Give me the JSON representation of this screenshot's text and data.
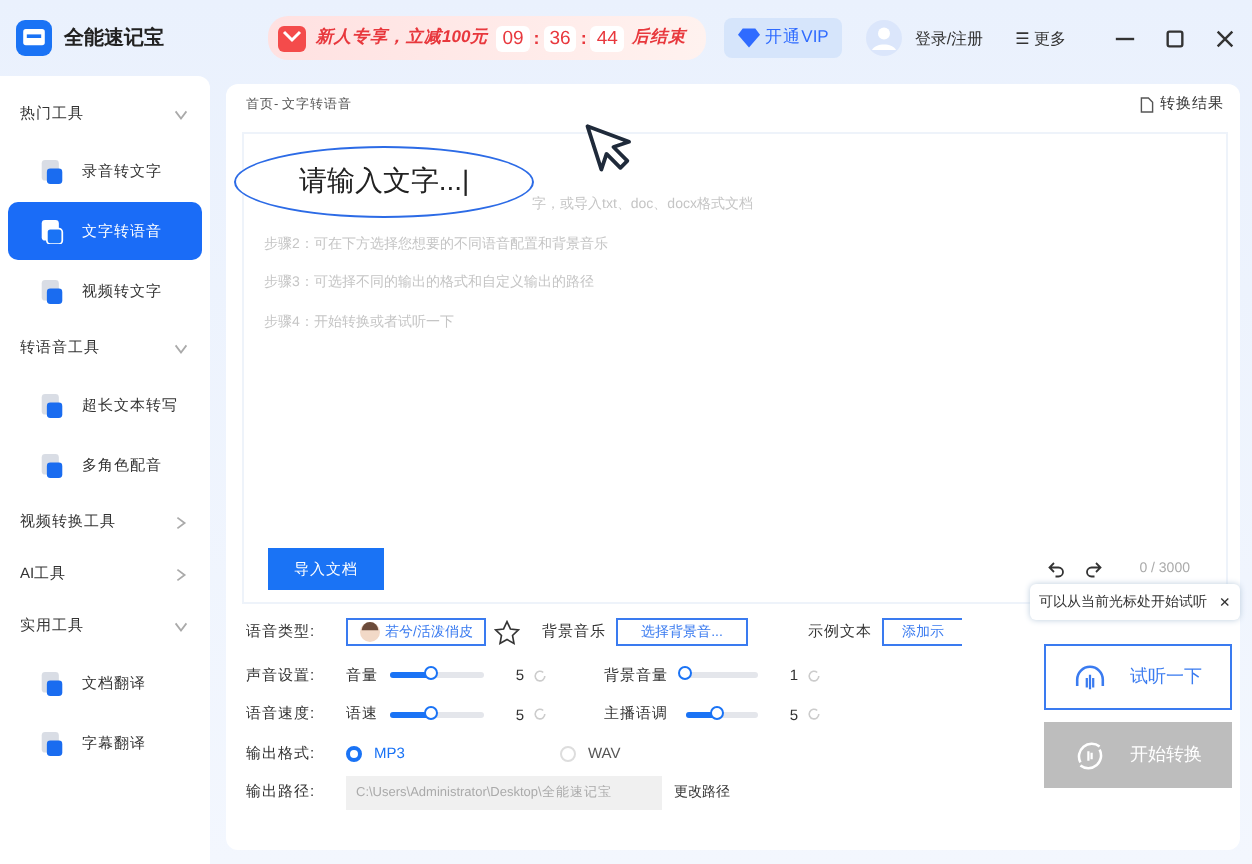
{
  "app": {
    "title": "全能速记宝"
  },
  "promo": {
    "text": "新人专享，立减100元",
    "timer": [
      "09",
      "36",
      "44"
    ],
    "separator": ":",
    "suffix": "后结束"
  },
  "header": {
    "vip": "开通VIP",
    "login": "登录/注册",
    "more_icon": "☰",
    "more": "更多"
  },
  "sidebar": [
    {
      "label": "热门工具",
      "expanded": true,
      "items": [
        {
          "label": "录音转文字",
          "selected": false
        },
        {
          "label": "文字转语音",
          "selected": true
        },
        {
          "label": "视频转文字",
          "selected": false
        }
      ]
    },
    {
      "label": "转语音工具",
      "expanded": true,
      "items": [
        {
          "label": "超长文本转写",
          "selected": false
        },
        {
          "label": "多角色配音",
          "selected": false
        }
      ]
    },
    {
      "label": "视频转换工具",
      "expanded": false
    },
    {
      "label": "AI工具",
      "expanded": false
    },
    {
      "label": "实用工具",
      "expanded": true,
      "items": [
        {
          "label": "文档翻译",
          "selected": false
        },
        {
          "label": "字幕翻译",
          "selected": false
        }
      ]
    }
  ],
  "breadcrumb": "首页- 文字转语音",
  "result_link": "转换结果",
  "editor": {
    "steps": [
      "字，或导入txt、doc、docx格式文档",
      "步骤2：可在下方选择您想要的不同语音配置和背景音乐",
      "步骤3：可选择不同的输出的格式和自定义输出的路径",
      "步骤4：开始转换或者试听一下"
    ],
    "import_button": "导入文档",
    "counter": "0 / 3000"
  },
  "callout": {
    "text": "请输入文字...|"
  },
  "settings": {
    "voice_label": "语音类型:",
    "voice_button": "若兮/活泼俏皮",
    "favorite": false,
    "music_label": "背景音乐",
    "music_button": "选择背景音...",
    "sample_label": "示例文本",
    "sample_button": "添加示",
    "slider_rows": [
      {
        "label": "声音设置:",
        "sliders": [
          {
            "label": "音量",
            "level": 0.45,
            "reading": "5"
          },
          {
            "label": "背景音量",
            "level": 0,
            "reading": "1"
          }
        ]
      },
      {
        "label": "语音速度:",
        "sliders": [
          {
            "label": "语速",
            "level": 0.45,
            "reading": "5"
          },
          {
            "label": "主播语调",
            "level": 0.45,
            "reading": "5"
          }
        ]
      }
    ],
    "format_label": "输出格式:",
    "formats": [
      {
        "label": "MP3",
        "selected": true
      },
      {
        "label": "WAV",
        "selected": false
      }
    ],
    "path_label": "输出路径:",
    "path": "C:\\Users\\Administrator\\Desktop\\全能速记宝",
    "change_path": "更改路径"
  },
  "tooltip": {
    "text": "可以从当前光标处开始试听",
    "close": "×"
  },
  "preview_button": {
    "label": "试听一下",
    "disabled": false
  },
  "start_button": {
    "label": "开始转换",
    "disabled": true
  }
}
